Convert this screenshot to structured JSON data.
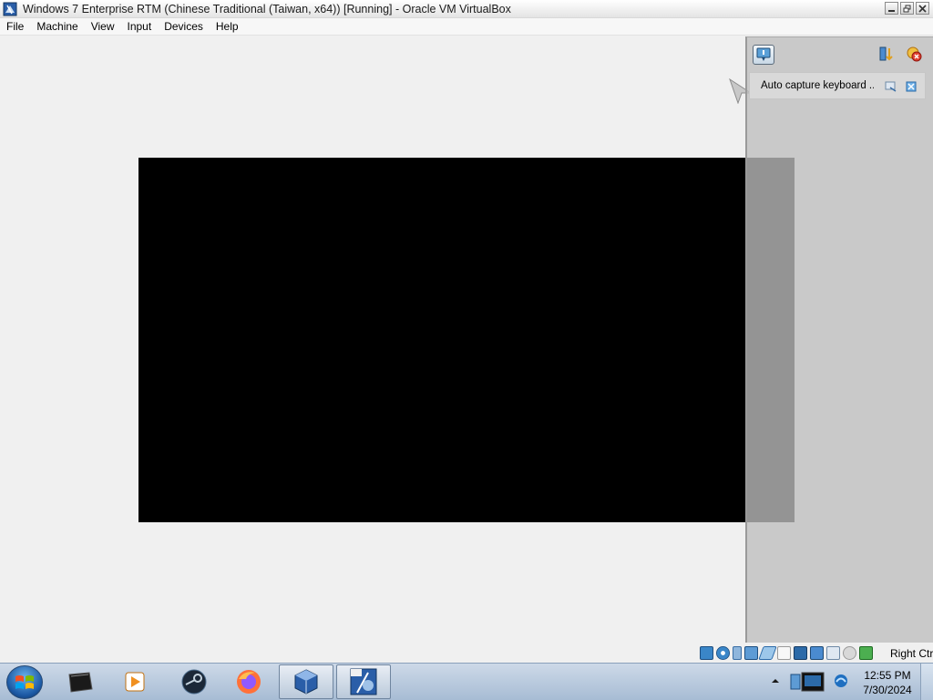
{
  "window": {
    "title": "Windows 7 Enterprise RTM (Chinese Traditional (Taiwan, x64)) [Running] - Oracle VM VirtualBox",
    "app_icon": "virtualbox-icon",
    "controls": [
      "minimize-icon",
      "restore-icon",
      "close-icon"
    ]
  },
  "menubar": {
    "items": [
      {
        "label": "File"
      },
      {
        "label": "Machine"
      },
      {
        "label": "View"
      },
      {
        "label": "Input"
      },
      {
        "label": "Devices"
      },
      {
        "label": "Help"
      }
    ]
  },
  "side_panel": {
    "main_button_icon": "notification-center-icon",
    "tools": [
      "toggle-ordering-icon",
      "dismiss-all-icon"
    ],
    "notification": {
      "text": "Auto capture keyboard ...",
      "icons": [
        "details-icon",
        "close-icon"
      ]
    }
  },
  "statusbar": {
    "icons": [
      "hard-disk-icon",
      "optical-drive-icon",
      "audio-icon",
      "network-icon",
      "usb-icon",
      "shared-folders-icon",
      "display-icon",
      "video-capture-icon",
      "mouse-integration-icon",
      "cpu-icon",
      "keyboard-icon"
    ],
    "host_key": "Right Ctrl"
  },
  "taskbar": {
    "start_icon": "windows-start-icon",
    "apps": [
      "terminal-icon",
      "media-player-icon",
      "steam-icon",
      "firefox-icon",
      "virtualbox-manager-icon",
      "virtualbox-vm-icon"
    ],
    "tray_icons": [
      "show-hidden-icons-icon",
      "network-monitor-icon",
      "edge-icon"
    ],
    "time": "12:55 PM",
    "date": "7/30/2024"
  },
  "colors": {
    "vm_screen": "#000000",
    "panel": "#bebebe",
    "taskbar": "#b9c9dc"
  }
}
